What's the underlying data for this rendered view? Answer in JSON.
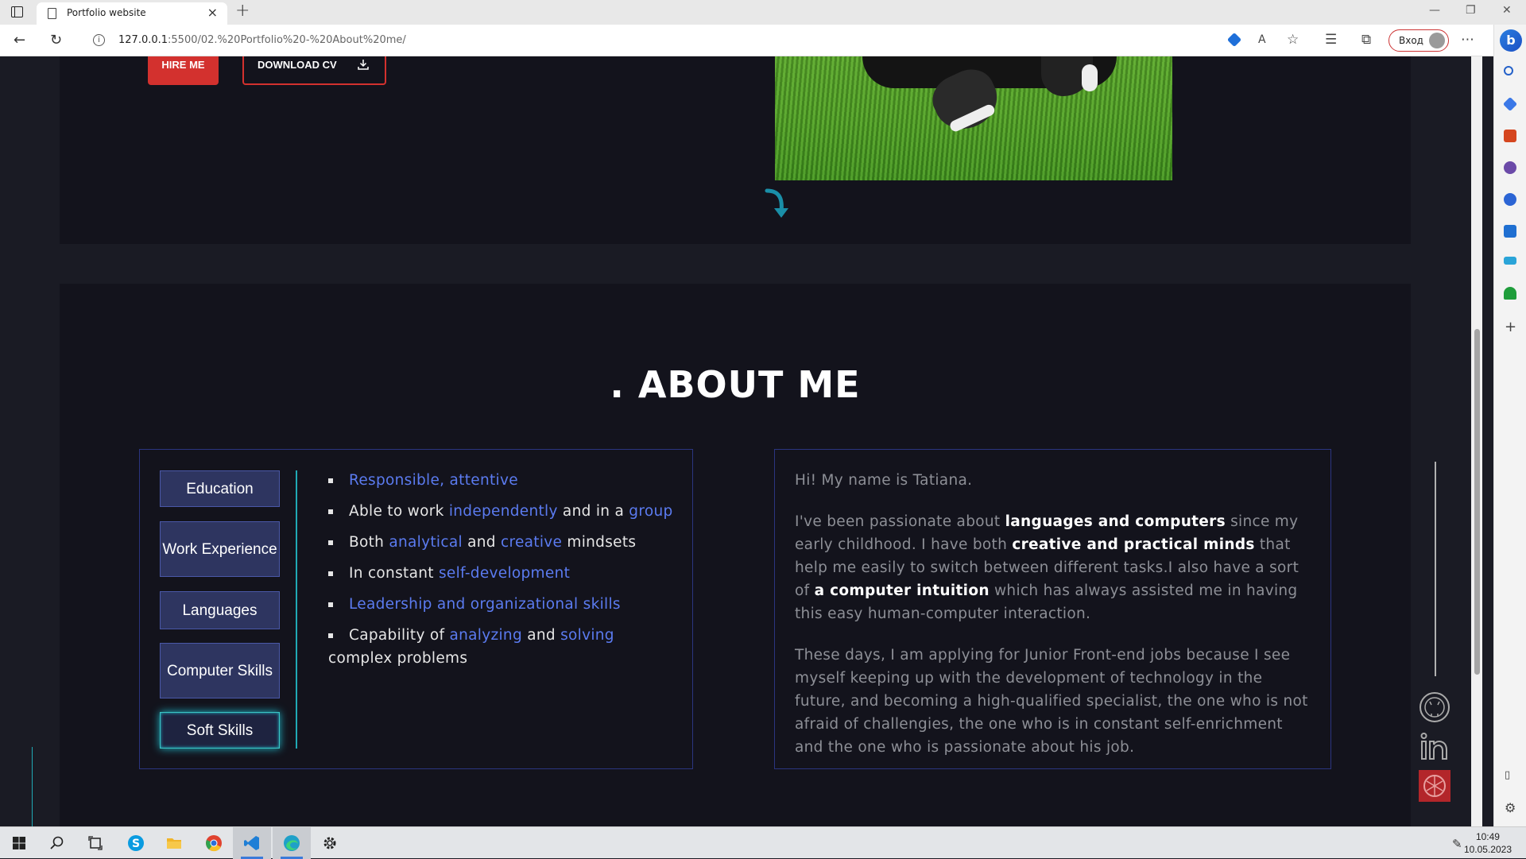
{
  "browser": {
    "tab_title": "Portfolio website",
    "new_tab": "+",
    "tab_close": "×",
    "url_host": "127.0.0.1",
    "url_path": ":5500/02.%20Portfolio%20-%20About%20me/",
    "login_label": "Вход"
  },
  "hero": {
    "hire_label": "HIRE ME",
    "cv_label": "DOWNLOAD CV"
  },
  "about": {
    "title": ". ABOUT ME",
    "tabs": [
      {
        "label": "Education"
      },
      {
        "label": "Work Experience"
      },
      {
        "label": "Languages"
      },
      {
        "label": "Computer Skills"
      },
      {
        "label": "Soft Skills"
      }
    ],
    "active_tab": "Soft Skills",
    "soft_skills": {
      "item1": {
        "a": "Responsible, attentive"
      },
      "item2": {
        "a": "Able to work ",
        "b": "independently",
        "c": " and in a ",
        "d": "group"
      },
      "item3": {
        "a": "Both ",
        "b": "analytical",
        "c": " and ",
        "d": "creative",
        "e": " mindsets"
      },
      "item4": {
        "a": "In constant ",
        "b": "self-development"
      },
      "item5": {
        "a": "Leadership and organizational skills"
      },
      "item6": {
        "a": "Capability of ",
        "b": "analyzing",
        "c": " and ",
        "d": "solving",
        "e": "complex problems"
      }
    },
    "intro": {
      "p1": "Hi! My name is Tatiana.",
      "p2": {
        "a": "I've been passionate about ",
        "b": "languages and computers",
        "c": " since my early childhood. I have both ",
        "d": "creative and practical minds",
        "e": " that help me easily to switch between different tasks.I also have a sort of ",
        "f": "a computer intuition",
        "g": " which has always assisted me in having this easy human-computer interaction."
      },
      "p3": "These days, I am applying for Junior Front-end jobs because I see myself keeping up with the development of technology in the future, and becoming a high-qualified specialist, the one who is not afraid of challengies, the one who is in constant self-enrichment and the one who is passionate about his job."
    }
  },
  "taskbar": {
    "time": "10:49",
    "date": "10.05.2023"
  },
  "colors": {
    "page_bg": "#1a1b24",
    "section_bg": "#13131c",
    "accent_red": "#d3312e",
    "accent_teal": "#20a9b5",
    "highlight_blue": "#5b7bf0",
    "box_border": "#2b3580"
  }
}
